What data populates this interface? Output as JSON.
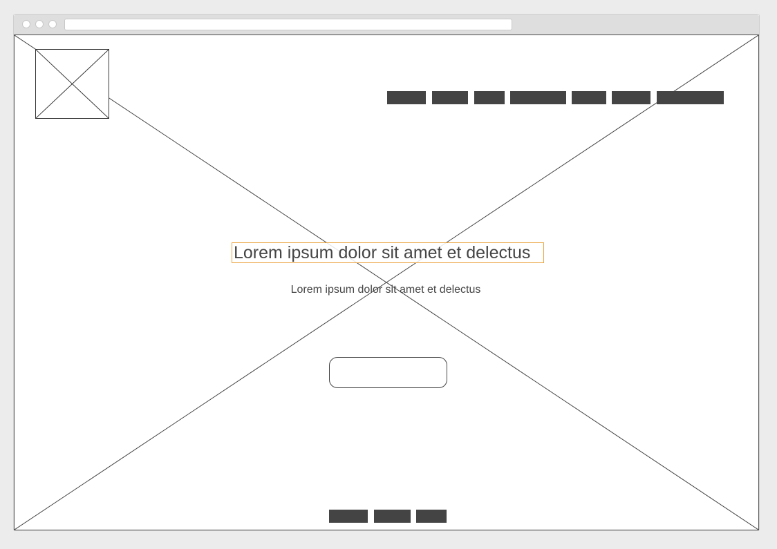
{
  "hero": {
    "title": "Lorem ipsum dolor sit amet et delectus",
    "subtitle": "Lorem ipsum dolor sit amet et delectus",
    "cta_label": ""
  },
  "colors": {
    "nav_block": "#444444",
    "highlight_border": "#e8a33c",
    "page_background": "#ececec"
  }
}
